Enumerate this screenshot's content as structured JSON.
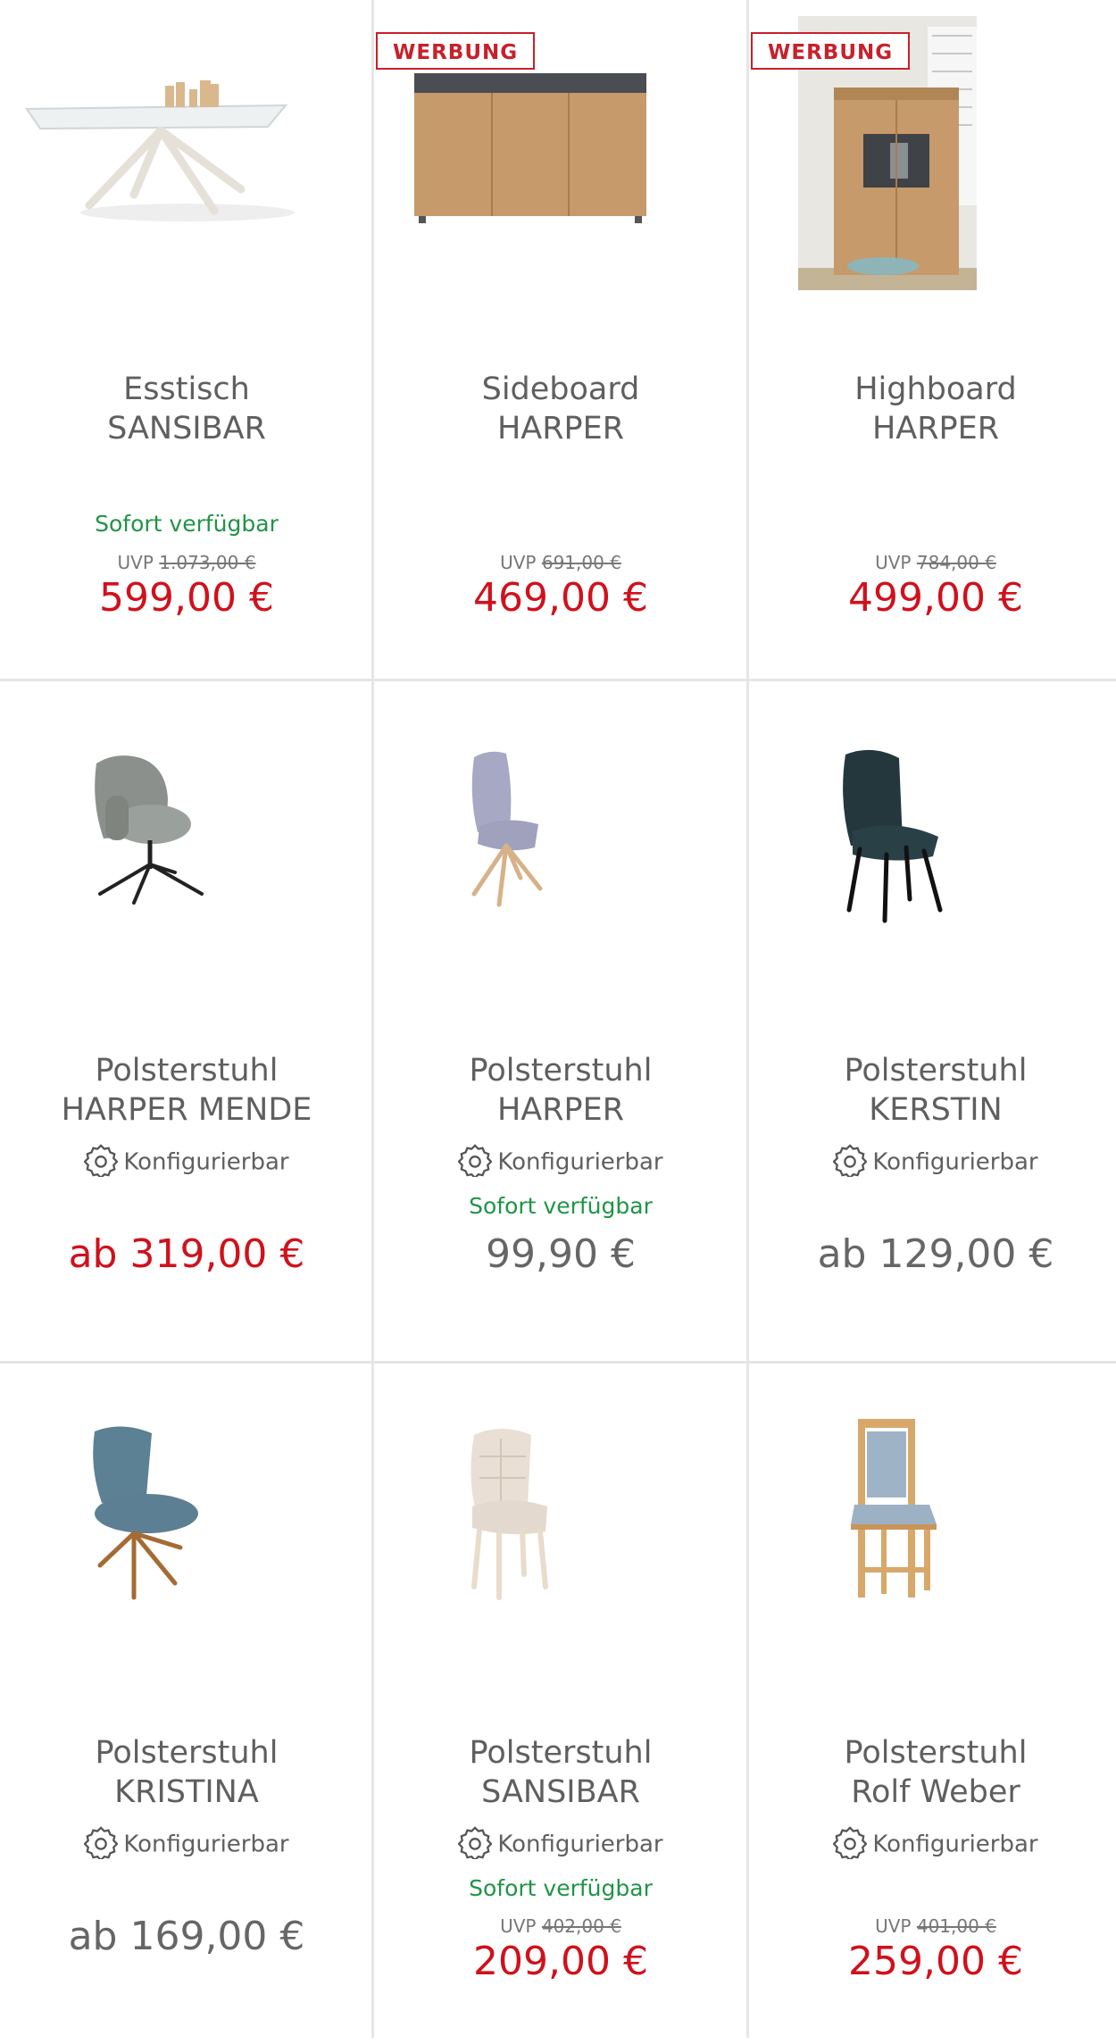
{
  "colors": {
    "sale": "#d0111c",
    "available": "#1f9446",
    "ad_badge": "#c8202a",
    "text": "#5f5f5f",
    "divider": "#e6e6e6"
  },
  "products": [
    {
      "line1": "Esstisch",
      "line2": "SANSIBAR",
      "badge": "",
      "configurable": "",
      "availability": "Sofort verfügbar",
      "uvp_label": "UVP",
      "uvp_value": "1.073,00 €",
      "price": "599,00 €",
      "price_style": "sale",
      "image": "dining-table"
    },
    {
      "line1": "Sideboard",
      "line2": "HARPER",
      "badge": "WERBUNG",
      "configurable": "",
      "availability": "",
      "uvp_label": "UVP",
      "uvp_value": "691,00 €",
      "price": "469,00 €",
      "price_style": "sale",
      "image": "sideboard"
    },
    {
      "line1": "Highboard",
      "line2": "HARPER",
      "badge": "WERBUNG",
      "configurable": "",
      "availability": "",
      "uvp_label": "UVP",
      "uvp_value": "784,00 €",
      "price": "499,00 €",
      "price_style": "sale",
      "image": "highboard"
    },
    {
      "line1": "Polsterstuhl",
      "line2": "HARPER MENDE",
      "badge": "",
      "configurable": "Konfigurierbar",
      "availability": "",
      "uvp_label": "",
      "uvp_value": "",
      "price": "ab 319,00 €",
      "price_style": "sale",
      "image": "armchair-grey"
    },
    {
      "line1": "Polsterstuhl",
      "line2": "HARPER",
      "badge": "",
      "configurable": "Konfigurierbar",
      "availability": "Sofort verfügbar",
      "uvp_label": "",
      "uvp_value": "",
      "price": "99,90 €",
      "price_style": "normal",
      "image": "chair-lavender"
    },
    {
      "line1": "Polsterstuhl",
      "line2": "KERSTIN",
      "badge": "",
      "configurable": "Konfigurierbar",
      "availability": "",
      "uvp_label": "",
      "uvp_value": "",
      "price": "ab 129,00 €",
      "price_style": "normal",
      "image": "chair-darkgreen"
    },
    {
      "line1": "Polsterstuhl",
      "line2": "KRISTINA",
      "badge": "",
      "configurable": "Konfigurierbar",
      "availability": "",
      "uvp_label": "",
      "uvp_value": "",
      "price": "ab 169,00 €",
      "price_style": "normal",
      "image": "chair-blue"
    },
    {
      "line1": "Polsterstuhl",
      "line2": "SANSIBAR",
      "badge": "",
      "configurable": "Konfigurierbar",
      "availability": "Sofort verfügbar",
      "uvp_label": "UVP",
      "uvp_value": "402,00 €",
      "price": "209,00 €",
      "price_style": "sale",
      "image": "chair-beige"
    },
    {
      "line1": "Polsterstuhl",
      "line2": "Rolf Weber",
      "badge": "",
      "configurable": "Konfigurierbar",
      "availability": "",
      "uvp_label": "UVP",
      "uvp_value": "401,00 €",
      "price": "259,00 €",
      "price_style": "sale",
      "image": "chair-wood"
    }
  ]
}
